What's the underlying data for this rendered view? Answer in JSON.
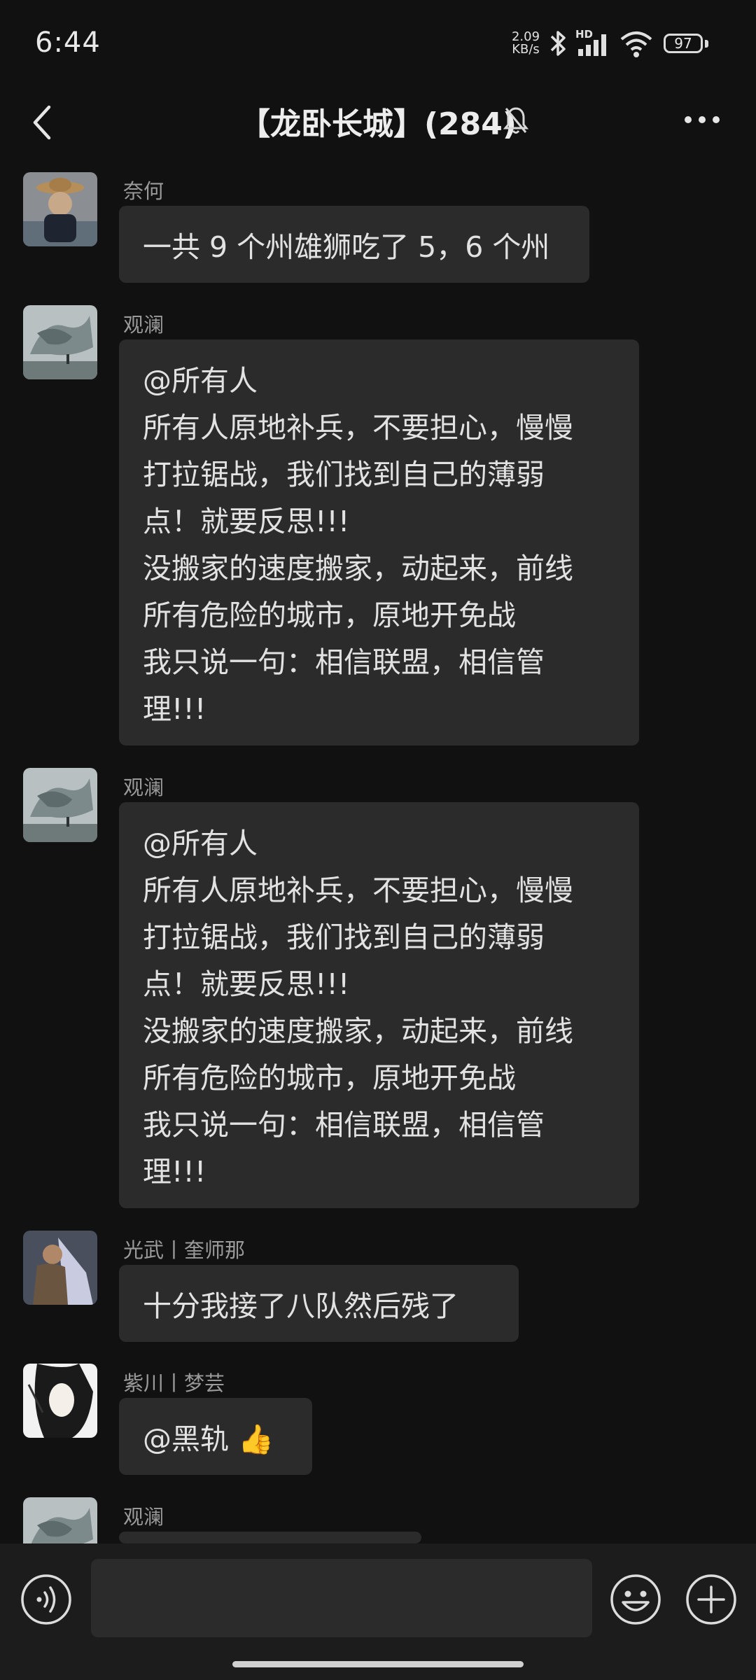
{
  "status_bar": {
    "time": "6:44",
    "net_speed_value": "2.09",
    "net_speed_unit": "KB/s",
    "hd_label": "HD",
    "battery": "97"
  },
  "header": {
    "title": "【龙卧长城】(284)"
  },
  "messages": [
    {
      "sender": "奈何",
      "text": "一共 9 个州雄狮吃了 5，6 个州"
    },
    {
      "sender": "观澜",
      "text": "@所有人\n所有人原地补兵，不要担心，慢慢\n打拉锯战，我们找到自己的薄弱\n点！就要反思!!!\n没搬家的速度搬家，动起来，前线\n所有危险的城市，原地开免战\n我只说一句：相信联盟，相信管\n理!!!"
    },
    {
      "sender": "观澜",
      "text": "@所有人\n所有人原地补兵，不要担心，慢慢\n打拉锯战，我们找到自己的薄弱\n点！就要反思!!!\n没搬家的速度搬家，动起来，前线\n所有危险的城市，原地开免战\n我只说一句：相信联盟，相信管\n理!!!"
    },
    {
      "sender": "光武丨奎师那",
      "text": "十分我接了八队然后残了"
    },
    {
      "sender": "紫川丨梦芸",
      "text": "@黑轨 👍"
    },
    {
      "sender": "观澜",
      "text": ""
    }
  ],
  "composer": {
    "value": "",
    "placeholder": ""
  },
  "colors": {
    "background": "#111111",
    "bubble": "#2b2b2b",
    "sender": "#9a9a9a"
  }
}
